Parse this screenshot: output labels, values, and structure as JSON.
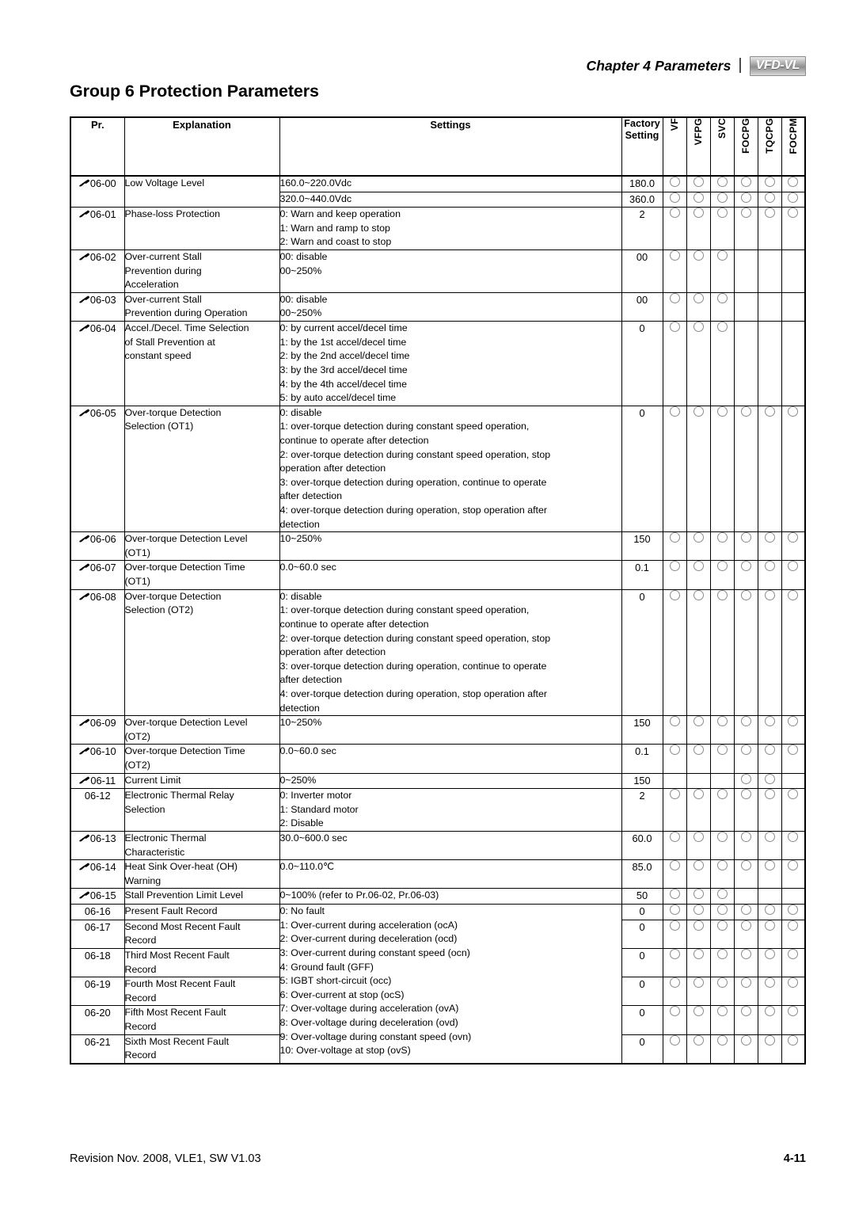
{
  "header": {
    "chapter": "Chapter 4 Parameters",
    "divider": "|",
    "logo": "VFD-VL"
  },
  "title": "Group 6 Protection Parameters",
  "table": {
    "columns": {
      "pr": "Pr.",
      "explanation": "Explanation",
      "settings": "Settings",
      "factory_line1": "Factory",
      "factory_line2": "Setting",
      "modes": [
        "VF",
        "VFPG",
        "SVC",
        "FOCPG",
        "TQCPG",
        "FOCPM"
      ]
    },
    "rows": [
      {
        "pr": "06-00",
        "pen": true,
        "explanation": [
          "Low Voltage Level"
        ],
        "sub": [
          {
            "settings": [
              "160.0~220.0Vdc"
            ],
            "factory": "180.0",
            "modes": [
              1,
              1,
              1,
              1,
              1,
              1
            ]
          },
          {
            "settings": [
              "320.0~440.0Vdc"
            ],
            "factory": "360.0",
            "modes": [
              1,
              1,
              1,
              1,
              1,
              1
            ]
          }
        ]
      },
      {
        "pr": "06-01",
        "pen": true,
        "explanation": [
          "Phase-loss Protection"
        ],
        "settings": [
          "0: Warn and keep operation",
          "1: Warn and ramp to stop",
          "2: Warn and coast to stop"
        ],
        "factory": "2",
        "modes": [
          1,
          1,
          1,
          1,
          1,
          1
        ]
      },
      {
        "pr": "06-02",
        "pen": true,
        "explanation": [
          "Over-current Stall",
          "Prevention during",
          "Acceleration"
        ],
        "settings": [
          "00: disable",
          "00~250%"
        ],
        "factory": "00",
        "modes": [
          1,
          1,
          1,
          0,
          0,
          0
        ]
      },
      {
        "pr": "06-03",
        "pen": true,
        "explanation": [
          "Over-current Stall",
          "Prevention during Operation"
        ],
        "settings": [
          "00: disable",
          "00~250%"
        ],
        "factory": "00",
        "modes": [
          1,
          1,
          1,
          0,
          0,
          0
        ]
      },
      {
        "pr": "06-04",
        "pen": true,
        "explanation": [
          "Accel./Decel. Time Selection",
          "of Stall Prevention  at",
          "constant speed"
        ],
        "settings": [
          "0: by current accel/decel time",
          "1: by the 1st accel/decel time",
          "2: by the 2nd accel/decel time",
          "3: by the 3rd accel/decel time",
          "4: by the 4th accel/decel time",
          "5: by auto accel/decel time"
        ],
        "factory": "0",
        "modes": [
          1,
          1,
          1,
          0,
          0,
          0
        ]
      },
      {
        "pr": "06-05",
        "pen": true,
        "explanation": [
          "Over-torque Detection",
          "Selection (OT1)"
        ],
        "settings": [
          "0: disable",
          "1: over-torque detection during constant speed operation,",
          "continue to operate after detection",
          "2: over-torque detection during constant speed operation, stop",
          "operation after detection",
          "3: over-torque detection during operation, continue to operate",
          "after detection",
          "4: over-torque detection during operation, stop operation after",
          "detection"
        ],
        "factory": "0",
        "modes": [
          1,
          1,
          1,
          1,
          1,
          1
        ]
      },
      {
        "pr": "06-06",
        "pen": true,
        "explanation": [
          "Over-torque Detection Level",
          "(OT1)"
        ],
        "settings": [
          "10~250%"
        ],
        "factory": "150",
        "modes": [
          1,
          1,
          1,
          1,
          1,
          1
        ]
      },
      {
        "pr": "06-07",
        "pen": true,
        "explanation": [
          "Over-torque Detection Time",
          "(OT1)"
        ],
        "settings": [
          "0.0~60.0 sec"
        ],
        "factory": "0.1",
        "modes": [
          1,
          1,
          1,
          1,
          1,
          1
        ]
      },
      {
        "pr": "06-08",
        "pen": true,
        "explanation": [
          "Over-torque Detection",
          "Selection (OT2)"
        ],
        "settings": [
          "0: disable",
          "1: over-torque detection during constant speed operation,",
          "continue to operate after detection",
          "2: over-torque detection during constant speed operation, stop",
          "operation after detection",
          "3: over-torque detection during operation, continue to operate",
          "after detection",
          "4: over-torque detection during operation, stop operation after",
          "detection"
        ],
        "factory": "0",
        "modes": [
          1,
          1,
          1,
          1,
          1,
          1
        ]
      },
      {
        "pr": "06-09",
        "pen": true,
        "explanation": [
          "Over-torque Detection Level",
          "(OT2)"
        ],
        "settings": [
          "10~250%"
        ],
        "factory": "150",
        "modes": [
          1,
          1,
          1,
          1,
          1,
          1
        ]
      },
      {
        "pr": "06-10",
        "pen": true,
        "explanation": [
          "Over-torque Detection Time",
          "(OT2)"
        ],
        "settings": [
          "0.0~60.0 sec"
        ],
        "factory": "0.1",
        "modes": [
          1,
          1,
          1,
          1,
          1,
          1
        ]
      },
      {
        "pr": "06-11",
        "pen": true,
        "explanation": [
          "Current Limit"
        ],
        "settings": [
          "0~250%"
        ],
        "factory": "150",
        "modes": [
          0,
          0,
          0,
          1,
          1,
          0
        ]
      },
      {
        "pr": "06-12",
        "pen": false,
        "explanation": [
          "Electronic Thermal Relay",
          "Selection"
        ],
        "settings": [
          "0: Inverter motor",
          "1: Standard motor",
          "2: Disable"
        ],
        "factory": "2",
        "modes": [
          1,
          1,
          1,
          1,
          1,
          1
        ]
      },
      {
        "pr": "06-13",
        "pen": true,
        "explanation": [
          "Electronic Thermal",
          "Characteristic"
        ],
        "settings": [
          "30.0~600.0 sec"
        ],
        "factory": "60.0",
        "modes": [
          1,
          1,
          1,
          1,
          1,
          1
        ]
      },
      {
        "pr": "06-14",
        "pen": true,
        "explanation": [
          "Heat Sink Over-heat (OH)",
          "Warning"
        ],
        "settings": [
          "0.0~110.0℃"
        ],
        "factory": "85.0",
        "modes": [
          1,
          1,
          1,
          1,
          1,
          1
        ]
      },
      {
        "pr": "06-15",
        "pen": true,
        "explanation": [
          "Stall Prevention Limit Level"
        ],
        "settings": [
          "0~100% (refer to Pr.06-02, Pr.06-03)"
        ],
        "factory": "50",
        "modes": [
          1,
          1,
          1,
          0,
          0,
          0
        ]
      }
    ],
    "fault_rows": [
      {
        "pr": "06-16",
        "pen": false,
        "explanation": [
          "Present Fault Record"
        ],
        "factory": "0",
        "modes": [
          1,
          1,
          1,
          1,
          1,
          1
        ]
      },
      {
        "pr": "06-17",
        "pen": false,
        "explanation": [
          "Second Most Recent Fault",
          "Record"
        ],
        "factory": "0",
        "modes": [
          1,
          1,
          1,
          1,
          1,
          1
        ]
      },
      {
        "pr": "06-18",
        "pen": false,
        "explanation": [
          "Third Most Recent Fault",
          "Record"
        ],
        "factory": "0",
        "modes": [
          1,
          1,
          1,
          1,
          1,
          1
        ]
      },
      {
        "pr": "06-19",
        "pen": false,
        "explanation": [
          "Fourth Most Recent Fault",
          "Record"
        ],
        "factory": "0",
        "modes": [
          1,
          1,
          1,
          1,
          1,
          1
        ]
      },
      {
        "pr": "06-20",
        "pen": false,
        "explanation": [
          "Fifth Most Recent Fault",
          "Record"
        ],
        "factory": "0",
        "modes": [
          1,
          1,
          1,
          1,
          1,
          1
        ]
      },
      {
        "pr": "06-21",
        "pen": false,
        "explanation": [
          "Sixth Most Recent Fault",
          "Record"
        ],
        "factory": "0",
        "modes": [
          1,
          1,
          1,
          1,
          1,
          1
        ]
      }
    ],
    "fault_settings": [
      "0: No fault",
      "1: Over-current during acceleration (ocA)",
      "2: Over-current during deceleration (ocd)",
      "3: Over-current during constant speed (ocn)",
      "4: Ground fault (GFF)",
      "5: IGBT short-circuit (occ)",
      "6: Over-current at stop (ocS)",
      "7: Over-voltage during acceleration (ovA)",
      "8: Over-voltage during deceleration (ovd)",
      "9: Over-voltage during constant speed (ovn)",
      "10: Over-voltage at stop (ovS)"
    ]
  },
  "footer": {
    "revision": "Revision Nov. 2008, VLE1, SW V1.03",
    "page": "4-11"
  }
}
